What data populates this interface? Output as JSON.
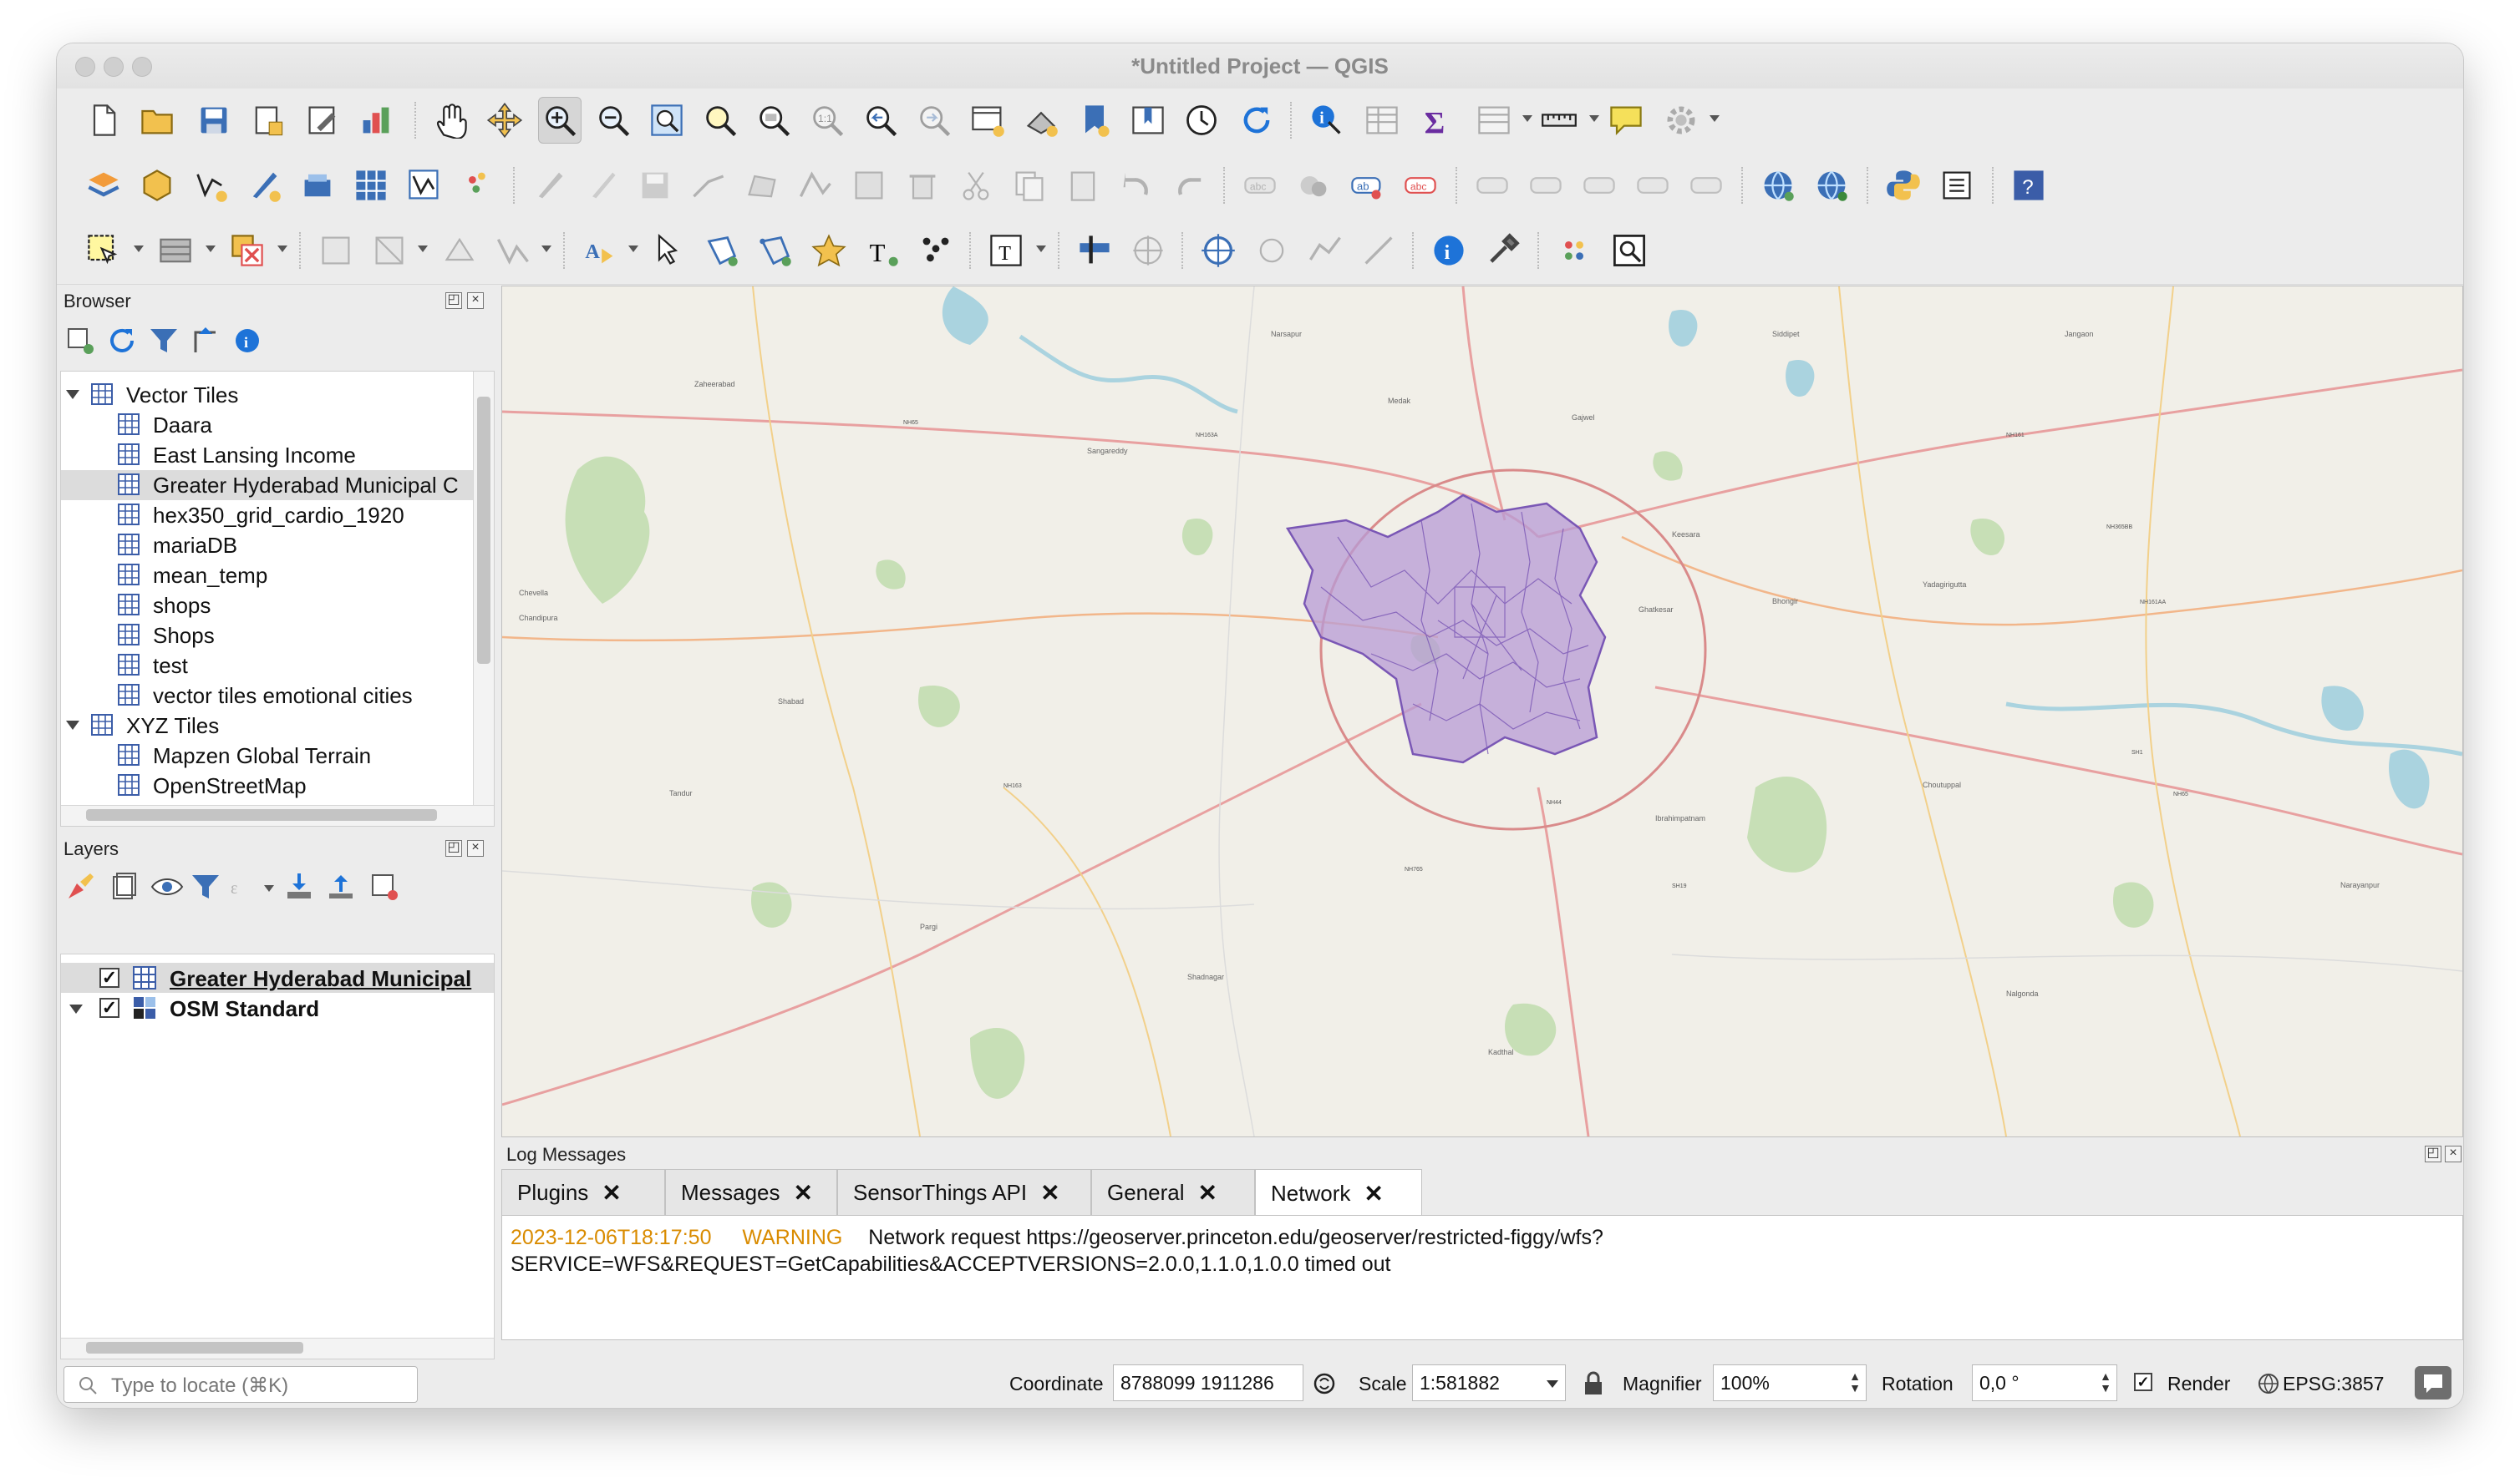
{
  "window": {
    "title": "*Untitled Project — QGIS"
  },
  "colors": {
    "accent": "#1e73d8",
    "warning": "#d98b00",
    "selection": "#dcdcdc",
    "hyderabad_fill": "#b79bd6",
    "hyderabad_stroke": "#7a57b5"
  },
  "toolbar_icons": [
    "new-project-icon",
    "open-project-icon",
    "save-project-icon",
    "print-layout-icon",
    "layout-manager-icon",
    "style-manager-icon",
    "pan-icon",
    "pan-to-selection-icon",
    "zoom-in-icon",
    "zoom-out-icon",
    "zoom-full-icon",
    "zoom-to-selection-icon",
    "zoom-to-layer-icon",
    "zoom-native-icon",
    "zoom-last-icon",
    "zoom-next-icon",
    "new-map-view-icon",
    "new-3d-view-icon",
    "new-bookmark-icon",
    "show-bookmarks-icon",
    "temporal-controller-icon",
    "refresh-icon",
    "identify-icon",
    "attribute-table-icon",
    "statistics-icon",
    "field-calculator-icon",
    "measure-icon",
    "map-tips-icon",
    "settings-icon"
  ],
  "browser": {
    "title": "Browser",
    "items": [
      {
        "label": "Vector Tiles",
        "level": 0,
        "expanded": true
      },
      {
        "label": "Daara",
        "level": 1
      },
      {
        "label": "East Lansing Income",
        "level": 1
      },
      {
        "label": "Greater Hyderabad Municipal C",
        "level": 1,
        "selected": true
      },
      {
        "label": "hex350_grid_cardio_1920",
        "level": 1
      },
      {
        "label": "mariaDB",
        "level": 1
      },
      {
        "label": "mean_temp",
        "level": 1
      },
      {
        "label": "shops",
        "level": 1
      },
      {
        "label": "Shops",
        "level": 1
      },
      {
        "label": "test",
        "level": 1
      },
      {
        "label": "vector tiles emotional cities",
        "level": 1
      },
      {
        "label": "XYZ Tiles",
        "level": 0,
        "expanded": true
      },
      {
        "label": "Mapzen Global Terrain",
        "level": 1
      },
      {
        "label": "OpenStreetMap",
        "level": 1
      }
    ]
  },
  "layers": {
    "title": "Layers",
    "items": [
      {
        "label": "Greater Hyderabad Municipal",
        "checked": true,
        "selected": true
      },
      {
        "label": "OSM Standard",
        "checked": true
      }
    ]
  },
  "map": {
    "place_labels": [
      "Zaheerabad",
      "Sangareddy",
      "Medak",
      "Siddipet",
      "Bhongir",
      "Nalgonda",
      "Chevella",
      "Chandipura",
      "Kadthal",
      "Shadnagar",
      "Keesara",
      "Ghatkesar",
      "Yadagirigutta",
      "Choutuppal",
      "Narayanpur",
      "Pargi",
      "Tandur",
      "Ibrahimpatnam",
      "Shabad",
      "Narsapur",
      "Jangaon",
      "Gajwel"
    ],
    "road_labels": [
      "NH65",
      "NH44",
      "NH163",
      "NH765",
      "NH161",
      "NH65",
      "SH19",
      "SH1",
      "NH163A",
      "NH365BB",
      "NH161AA"
    ]
  },
  "log": {
    "title": "Log Messages",
    "tabs": [
      {
        "label": "Plugins",
        "active": false
      },
      {
        "label": "Messages",
        "active": false
      },
      {
        "label": "SensorThings API",
        "active": false
      },
      {
        "label": "General",
        "active": false
      },
      {
        "label": "Network",
        "active": true
      }
    ],
    "entry": {
      "timestamp": "2023-12-06T18:17:50",
      "level": "WARNING",
      "line1": "Network request https://geoserver.princeton.edu/geoserver/restricted-figgy/wfs?",
      "line2": "SERVICE=WFS&REQUEST=GetCapabilities&ACCEPTVERSIONS=2.0.0,1.1.0,1.0.0 timed out"
    }
  },
  "status": {
    "locator_placeholder": "Type to locate (⌘K)",
    "coordinate_label": "Coordinate",
    "coordinate_value": "8788099  1911286",
    "scale_label": "Scale",
    "scale_value": "1:581882",
    "magnifier_label": "Magnifier",
    "magnifier_value": "100%",
    "rotation_label": "Rotation",
    "rotation_value": "0,0 °",
    "render_label": "Render",
    "render_checked": true,
    "crs": "EPSG:3857"
  }
}
